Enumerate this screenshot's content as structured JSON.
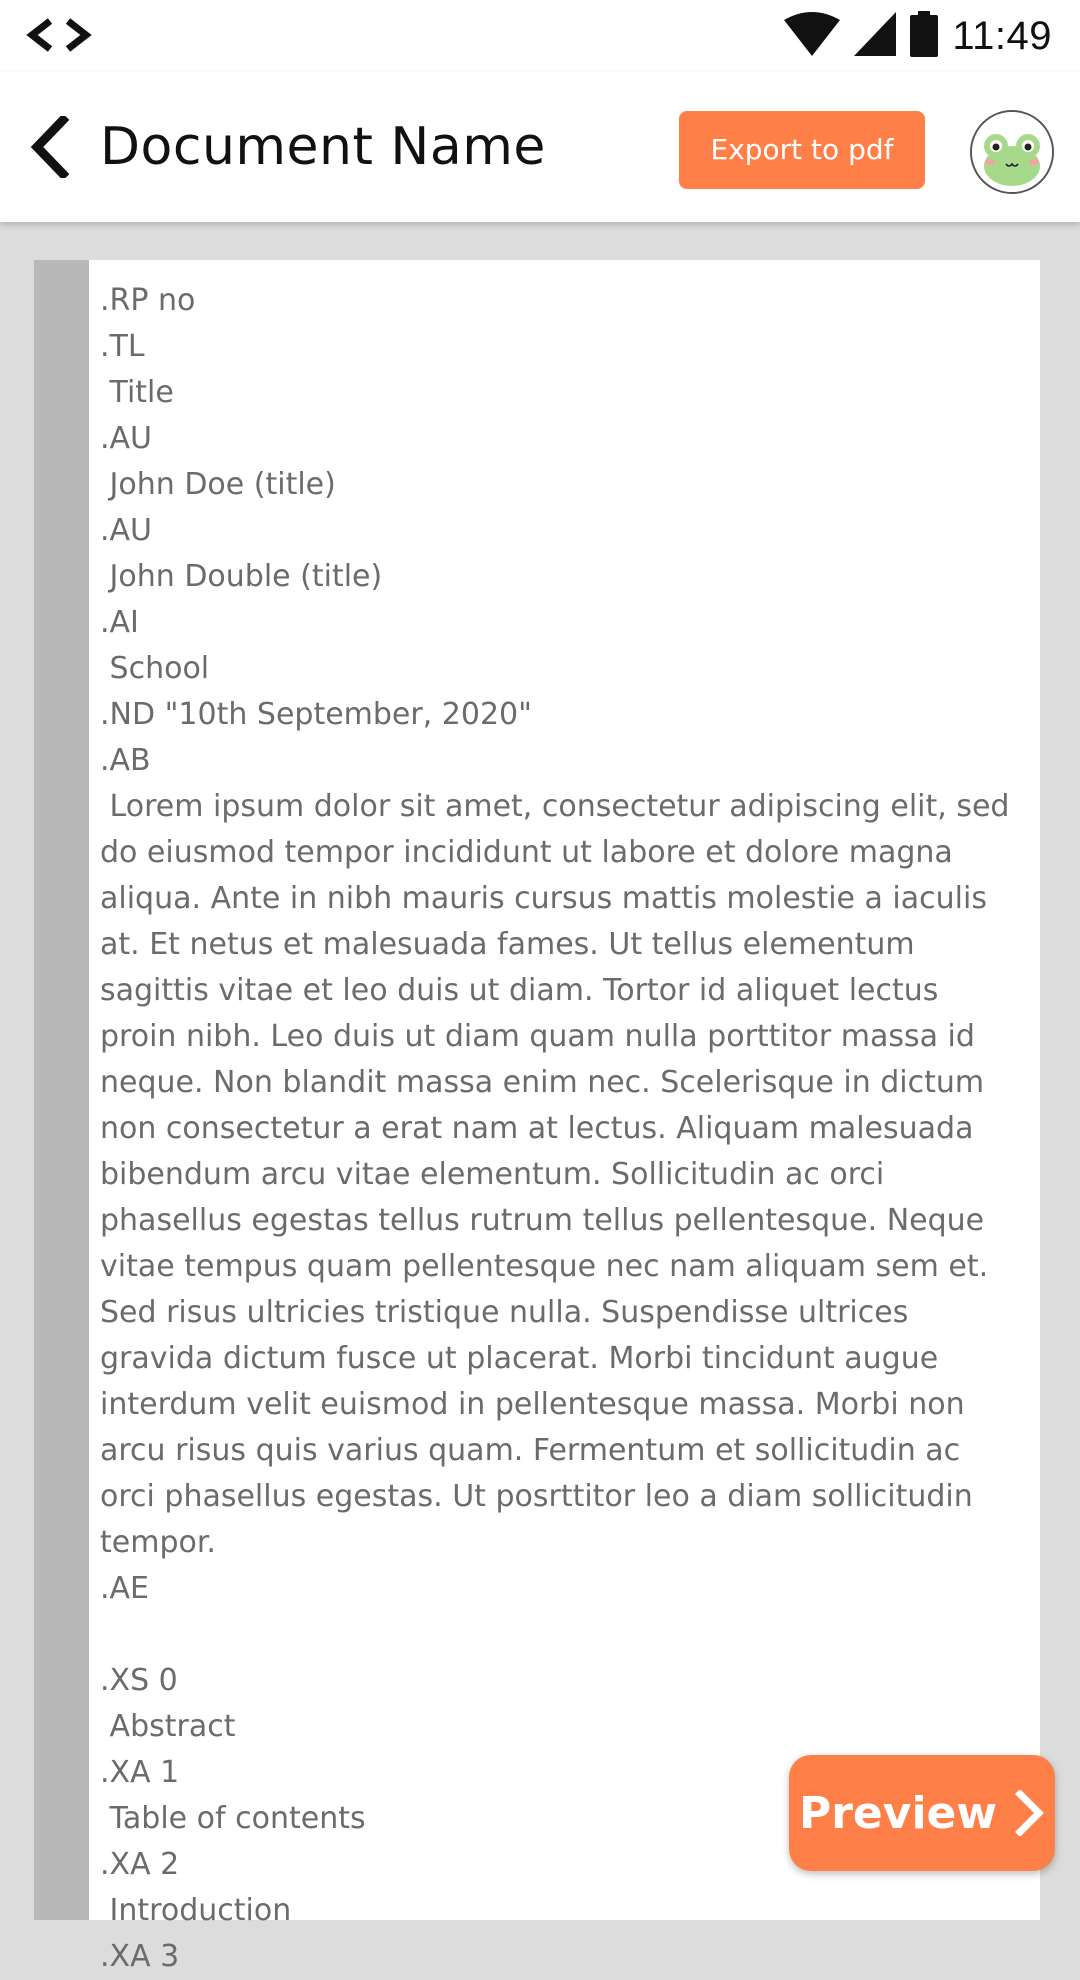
{
  "status_bar": {
    "app_icon": "code-brackets-icon",
    "wifi_icon": "wifi-icon",
    "signal_icon": "cell-signal-icon",
    "battery_icon": "battery-icon",
    "time": "11:49"
  },
  "app_bar": {
    "back_icon": "chevron-left-icon",
    "title": "Document Name",
    "export_label": "Export to pdf",
    "avatar_icon": "frog-avatar-icon"
  },
  "editor": {
    "content": ".RP no\n.TL\n Title\n.AU\n John Doe (title)\n.AU\n John Double (title)\n.AI\n School\n.ND \"10th September, 2020\"\n.AB\n Lorem ipsum dolor sit amet, consectetur adipiscing elit, sed do eiusmod tempor incididunt ut labore et dolore magna aliqua. Ante in nibh mauris cursus mattis molestie a iaculis at. Et netus et malesuada fames. Ut tellus elementum sagittis vitae et leo duis ut diam. Tortor id aliquet lectus proin nibh. Leo duis ut diam quam nulla porttitor massa id neque. Non blandit massa enim nec. Scelerisque in dictum non consectetur a erat nam at lectus. Aliquam malesuada bibendum arcu vitae elementum. Sollicitudin ac orci phasellus egestas tellus rutrum tellus pellentesque. Neque vitae tempus quam pellentesque nec nam aliquam sem et. Sed risus ultricies tristique nulla. Suspendisse ultrices gravida dictum fusce ut placerat. Morbi tincidunt augue interdum velit euismod in pellentesque massa. Morbi non arcu risus quis varius quam. Fermentum et sollicitudin ac orci phasellus egestas. Ut posrttitor leo a diam sollicitudin tempor.\n.AE\n\n.XS 0\n Abstract\n.XA 1\n Table of contents\n.XA 2\n Introduction\n.XA 3"
  },
  "preview_button": {
    "label": "Preview",
    "icon": "chevron-right-icon"
  },
  "colors": {
    "accent": "#ff7f49",
    "text": "#6b6b6b",
    "gutter": "#b8b8b8",
    "background": "#dcdcdc"
  }
}
